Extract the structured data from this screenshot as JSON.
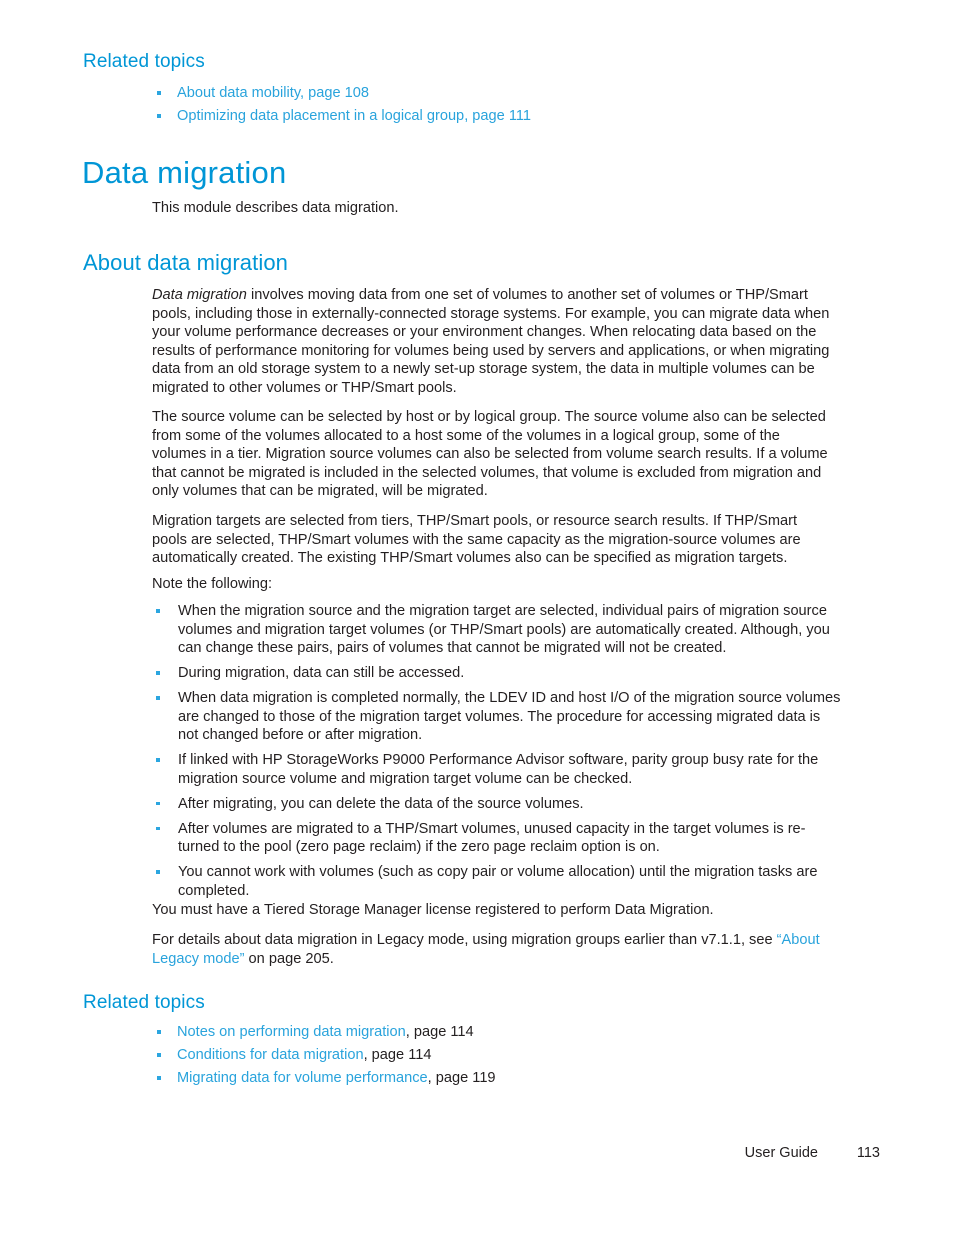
{
  "colors": {
    "heading_blue": "#0096d6",
    "link_blue": "#29a3dc",
    "bullet_blue": "#2ba6e0",
    "body_text": "#231f20"
  },
  "top_related": {
    "heading": "Related topics",
    "items": [
      {
        "link": "About data mobility",
        "page": ", page 108"
      },
      {
        "link": "Optimizing data placement in a logical group",
        "page": ", page 111"
      }
    ]
  },
  "chapter": {
    "title": "Data migration",
    "intro": "This module describes data migration."
  },
  "section": {
    "title": "About data migration",
    "paragraphs": {
      "p1_lead_italic": "Data migration",
      "p1_rest": " involves moving data from one set of volumes to another set of volumes or THP/Smart pools, including those in externally-connected storage systems. For example, you can migrate data when your volume performance decreases or your environment changes. When relocating data based on the results of performance monitoring for volumes being used by servers and applications, or when migrating data from an old storage system to a newly set-up storage system, the data in multiple volumes can be migrated to other volumes or THP/Smart pools.",
      "p2": "The source volume can be selected by host or by logical group. The source volume also can be selected from some of the volumes allocated to a host some of the volumes in a logical group, some of the volumes in a tier. Migration source volumes can also be selected from volume search results. If a volume that cannot be migrated is included in the selected volumes, that volume is excluded from migration and only volumes that can be migrated, will be migrated.",
      "p3": "Migration targets are selected from tiers, THP/Smart pools, or resource search results. If THP/Smart pools are selected, THP/Smart volumes with the same capacity as the migration-source volumes are automatically created. The existing THP/Smart volumes also can be specified as migration targets.",
      "p4": "Note the following:",
      "p5": "You must have a Tiered Storage Manager license registered to perform Data Migration.",
      "p6_before": "For details about data migration in Legacy mode, using migration groups earlier than v7.1.1, see ",
      "p6_quote_open": "“",
      "p6_link": "About Legacy mode",
      "p6_quote_close": "”",
      "p6_after": " on page 205."
    },
    "notes": [
      "When the migration source and the migration target are selected, individual pairs of migration source volumes and migration target volumes (or THP/Smart pools) are automatically created. Although, you can change these pairs, pairs of volumes that cannot be migrated will not be created.",
      "During migration, data can still be accessed.",
      "When data migration is completed normally, the LDEV ID and host I/O of the migration source volumes are changed to those of the migration target volumes. The procedure for accessing migrated data is not changed before or after migration.",
      "If linked with HP StorageWorks P9000 Performance Advisor software, parity group busy rate for the migration source volume and migration target volume can be checked.",
      "After migrating, you can delete the data of the source volumes.",
      "After volumes are migrated to a THP/Smart volumes, unused capacity in the target volumes is re-turned to the pool (zero page reclaim) if the zero page reclaim option is on.",
      "You cannot work with volumes (such as copy pair or volume allocation) until the migration tasks are completed."
    ]
  },
  "bottom_related": {
    "heading": "Related topics",
    "items": [
      {
        "link": "Notes on performing data migration",
        "page": ", page 114"
      },
      {
        "link": "Conditions for data migration",
        "page": ", page 114"
      },
      {
        "link": "Migrating data for volume performance",
        "page": ", page 119"
      }
    ]
  },
  "footer": {
    "guide_label": "User Guide",
    "page_number": "113"
  }
}
